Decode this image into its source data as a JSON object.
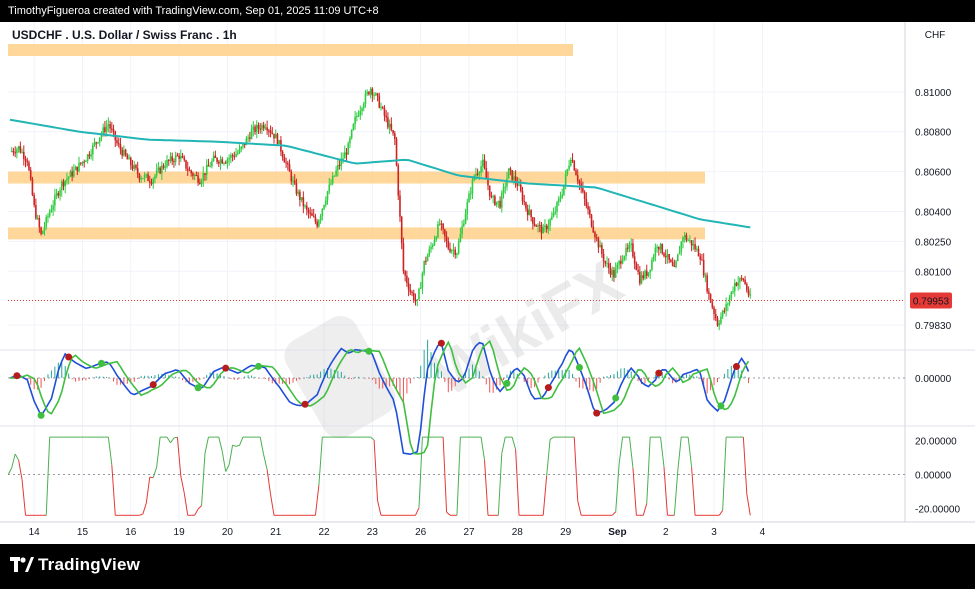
{
  "header": {
    "attribution": "TimothyFigueroa created with TradingView.com, Sep 01, 2025 11:09 UTC+8"
  },
  "footer": {
    "brand": "TradingView"
  },
  "watermark": {
    "text": "WikiFX"
  },
  "colors": {
    "bull": "#2ecc40",
    "bear": "#cc2222",
    "ma": "#22b5b5",
    "zone": "#ffd08a",
    "price_badge": "#e53935",
    "macd_fast": "#1f4fd8",
    "macd_green": "#3fbf3f",
    "macd_red": "#b71c1c",
    "osc_up": "#4caf50",
    "osc_down": "#e53935"
  },
  "chart_data": {
    "type": "candlestick",
    "title": "USDCHF . U.S. Dollar / Swiss Franc . 1h",
    "currency_label": "CHF",
    "x_tick_labels": [
      "14",
      "15",
      "16",
      "19",
      "20",
      "21",
      "22",
      "23",
      "26",
      "27",
      "28",
      "29",
      "Sep",
      "2",
      "3",
      "4"
    ],
    "price_axis": {
      "ticks": [
        "0.81000",
        "0.80800",
        "0.80600",
        "0.80400",
        "0.80250",
        "0.80100",
        "0.79830"
      ],
      "range": [
        0.7972,
        0.8124
      ]
    },
    "current_price": "0.79953",
    "zones": [
      {
        "from": 0.8118,
        "to": 0.8124
      },
      {
        "from": 0.8054,
        "to": 0.806
      },
      {
        "from": 0.8026,
        "to": 0.8032
      }
    ],
    "close_path": [
      [
        0,
        0.807
      ],
      [
        5,
        0.8072
      ],
      [
        10,
        0.8066
      ],
      [
        14,
        0.8042
      ],
      [
        18,
        0.8028
      ],
      [
        23,
        0.804
      ],
      [
        30,
        0.8054
      ],
      [
        37,
        0.806
      ],
      [
        45,
        0.8068
      ],
      [
        52,
        0.8078
      ],
      [
        57,
        0.8084
      ],
      [
        62,
        0.8074
      ],
      [
        68,
        0.8066
      ],
      [
        75,
        0.8058
      ],
      [
        82,
        0.8056
      ],
      [
        90,
        0.8064
      ],
      [
        98,
        0.8068
      ],
      [
        104,
        0.806
      ],
      [
        110,
        0.8056
      ],
      [
        118,
        0.8066
      ],
      [
        125,
        0.8066
      ],
      [
        133,
        0.807
      ],
      [
        140,
        0.808
      ],
      [
        148,
        0.8084
      ],
      [
        155,
        0.8076
      ],
      [
        160,
        0.8064
      ],
      [
        165,
        0.8052
      ],
      [
        172,
        0.804
      ],
      [
        178,
        0.8034
      ],
      [
        184,
        0.805
      ],
      [
        190,
        0.8062
      ],
      [
        196,
        0.8072
      ],
      [
        200,
        0.8086
      ],
      [
        204,
        0.8094
      ],
      [
        209,
        0.8102
      ],
      [
        213,
        0.8096
      ],
      [
        218,
        0.8086
      ],
      [
        223,
        0.8076
      ],
      [
        228,
        0.801
      ],
      [
        232,
        0.8
      ],
      [
        236,
        0.7994
      ],
      [
        240,
        0.8014
      ],
      [
        244,
        0.8022
      ],
      [
        249,
        0.8034
      ],
      [
        254,
        0.8022
      ],
      [
        259,
        0.802
      ],
      [
        264,
        0.804
      ],
      [
        269,
        0.8058
      ],
      [
        274,
        0.8064
      ],
      [
        279,
        0.8046
      ],
      [
        284,
        0.8044
      ],
      [
        289,
        0.806
      ],
      [
        294,
        0.8054
      ],
      [
        299,
        0.8042
      ],
      [
        304,
        0.8034
      ],
      [
        309,
        0.803
      ],
      [
        315,
        0.8038
      ],
      [
        320,
        0.805
      ],
      [
        325,
        0.8068
      ],
      [
        330,
        0.8054
      ],
      [
        335,
        0.804
      ],
      [
        340,
        0.8026
      ],
      [
        345,
        0.8014
      ],
      [
        350,
        0.8008
      ],
      [
        355,
        0.8018
      ],
      [
        360,
        0.8022
      ],
      [
        365,
        0.8006
      ],
      [
        370,
        0.801
      ],
      [
        375,
        0.8024
      ],
      [
        380,
        0.8018
      ],
      [
        385,
        0.801
      ],
      [
        390,
        0.8028
      ],
      [
        395,
        0.8024
      ],
      [
        400,
        0.8018
      ],
      [
        405,
        0.7998
      ],
      [
        410,
        0.7984
      ],
      [
        415,
        0.7992
      ],
      [
        420,
        0.8004
      ],
      [
        425,
        0.8006
      ],
      [
        429,
        0.7996
      ]
    ],
    "ma_path": [
      [
        0,
        0.8086
      ],
      [
        40,
        0.808
      ],
      [
        80,
        0.8076
      ],
      [
        120,
        0.8075
      ],
      [
        160,
        0.8073
      ],
      [
        200,
        0.8064
      ],
      [
        230,
        0.8066
      ],
      [
        260,
        0.8058
      ],
      [
        300,
        0.8054
      ],
      [
        340,
        0.8052
      ],
      [
        370,
        0.8044
      ],
      [
        400,
        0.8036
      ],
      [
        429,
        0.8032
      ]
    ],
    "macd_panel": {
      "ticks": [
        "0.00000"
      ],
      "marker_bars": [
        4,
        18,
        34,
        53,
        83,
        109,
        125,
        144,
        171,
        208,
        250,
        288,
        312,
        330,
        340,
        351,
        376,
        412,
        421
      ]
    },
    "oscillator_panel": {
      "ticks": [
        "20.00000",
        "0.00000",
        "-20.00000"
      ],
      "range": [
        -25,
        25
      ]
    }
  }
}
